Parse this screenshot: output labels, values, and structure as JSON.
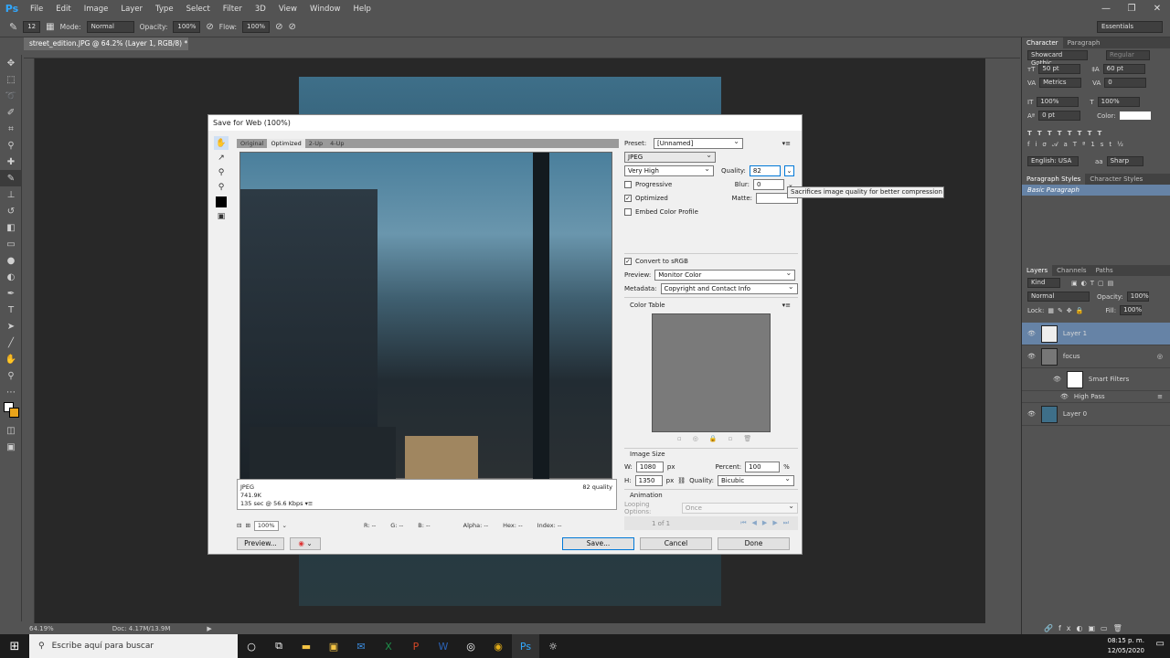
{
  "menu": {
    "logo": "Ps",
    "items": [
      "File",
      "Edit",
      "Image",
      "Layer",
      "Type",
      "Select",
      "Filter",
      "3D",
      "View",
      "Window",
      "Help"
    ]
  },
  "options": {
    "brush_size": "12",
    "mode_label": "Mode:",
    "mode": "Normal",
    "opacity_label": "Opacity:",
    "opacity": "100%",
    "flow_label": "Flow:",
    "flow": "100%",
    "workspace": "Essentials"
  },
  "document": {
    "tab": "street_edition.JPG @ 64.2% (Layer 1, RGB/8) *",
    "zoom": "64.19%",
    "doc_info": "Doc: 4.17M/13.9M"
  },
  "dialog": {
    "title": "Save for Web (100%)",
    "view_tabs": [
      "Original",
      "Optimized",
      "2-Up",
      "4-Up"
    ],
    "active_tab": "Optimized",
    "preview_info": {
      "format": "JPEG",
      "size": "741.9K",
      "time": "135 sec @ 56.6 Kbps",
      "quality": "82 quality"
    },
    "zoom": "100%",
    "readout": {
      "r": "R: --",
      "g": "G: --",
      "b": "B: --",
      "alpha": "Alpha: --",
      "hex": "Hex: --",
      "index": "Index: --"
    },
    "preset_label": "Preset:",
    "preset": "[Unnamed]",
    "format": "JPEG",
    "compression": "Very High",
    "quality_label": "Quality:",
    "quality": "82",
    "progressive": "Progressive",
    "blur_label": "Blur:",
    "blur": "0",
    "optimized": "Optimized",
    "matte_label": "Matte:",
    "embed": "Embed Color Profile",
    "convert": "Convert to sRGB",
    "preview_label": "Preview:",
    "preview_mode": "Monitor Color",
    "metadata_label": "Metadata:",
    "metadata": "Copyright and Contact Info",
    "color_table": "Color Table",
    "image_size": "Image Size",
    "w_label": "W:",
    "w": "1080",
    "h_label": "H:",
    "h": "1350",
    "px": "px",
    "percent_label": "Percent:",
    "percent": "100",
    "pct": "%",
    "quality_resample_label": "Quality:",
    "resample": "Bicubic",
    "animation": "Animation",
    "looping_label": "Looping Options:",
    "looping": "Once",
    "frame": "1 of 1",
    "buttons": {
      "preview": "Preview...",
      "save": "Save...",
      "cancel": "Cancel",
      "done": "Done"
    },
    "tooltip": "Sacrifices image quality for better compression"
  },
  "panels": {
    "char_tabs": [
      "Character",
      "Paragraph"
    ],
    "font": "Showcard Gothic",
    "style": "Regular",
    "size": "50 pt",
    "leading": "60 pt",
    "kerning": "Metrics",
    "tracking": "0",
    "vscale": "100%",
    "hscale": "100%",
    "baseline": "0 pt",
    "color_label": "Color:",
    "language": "English: USA",
    "aa": "Sharp",
    "para_tabs": [
      "Paragraph Styles",
      "Character Styles"
    ],
    "para_style": "Basic Paragraph",
    "layer_tabs": [
      "Layers",
      "Channels",
      "Paths"
    ],
    "kind": "Kind",
    "blend": "Normal",
    "opacity_label": "Opacity:",
    "opacity": "100%",
    "lock_label": "Lock:",
    "fill_label": "Fill:",
    "fill": "100%",
    "layers": [
      {
        "name": "Layer 1"
      },
      {
        "name": "focus"
      },
      {
        "name": "Smart Filters"
      },
      {
        "name": "High Pass"
      },
      {
        "name": "Layer 0"
      }
    ]
  },
  "taskbar": {
    "search": "Escribe aquí para buscar",
    "time": "08:15 p. m.",
    "date": "12/05/2020"
  }
}
